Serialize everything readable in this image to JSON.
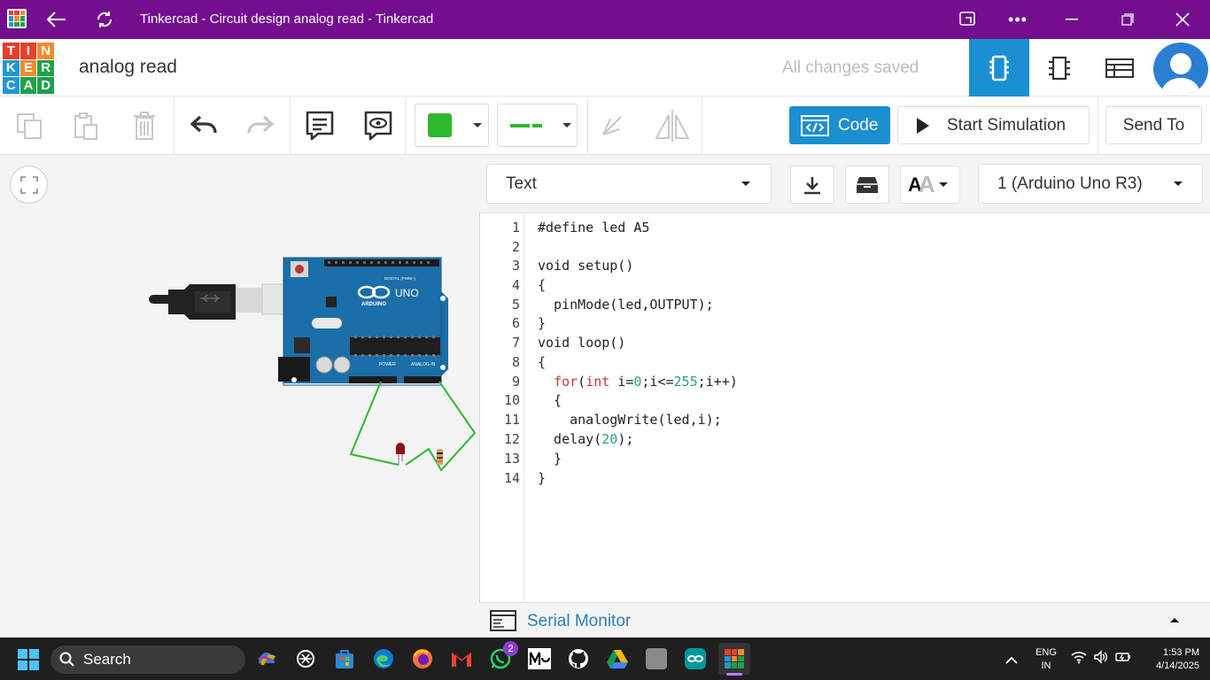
{
  "window": {
    "title": "Tinkercad - Circuit design analog read - Tinkercad"
  },
  "app": {
    "logo_letters": [
      "T",
      "I",
      "N",
      "K",
      "E",
      "R",
      "C",
      "A",
      "D"
    ],
    "logo_colors": [
      "#e23e2a",
      "#e8402c",
      "#f28b2b",
      "#2197d4",
      "#f28b2b",
      "#1fa14a",
      "#2197d4",
      "#1fa14a",
      "#1fa14a"
    ],
    "project_name": "analog read",
    "save_status": "All changes saved",
    "accent_color": "#1a8fd1"
  },
  "toolbar": {
    "code_label": "Code",
    "start_sim_label": "Start Simulation",
    "send_to_label": "Send To",
    "wire_color": "#2eb82e"
  },
  "code_panel": {
    "mode": "Text",
    "device": "1 (Arduino Uno R3)",
    "font_icon_label": "A",
    "lines": [
      "#define led A5",
      "",
      "void setup()",
      "{",
      "  pinMode(led,OUTPUT);",
      "}",
      "void loop()",
      "{",
      "  for(int i=0;i<=255;i++)",
      "  {",
      "    analogWrite(led,i);",
      "  delay(20);",
      "  }",
      "}"
    ],
    "line_numbers": [
      "1",
      "2",
      "3",
      "4",
      "5",
      "6",
      "7",
      "8",
      "9",
      "10",
      "11",
      "12",
      "13",
      "14"
    ],
    "serial_monitor_label": "Serial Monitor"
  },
  "board": {
    "brand": "ARDUINO",
    "model": "UNO",
    "labels": [
      "DIGITAL (PWM~)",
      "POWER",
      "ANALOG IN"
    ]
  },
  "taskbar": {
    "search_placeholder": "Search",
    "whatsapp_badge": "2",
    "lang": "ENG",
    "region": "IN",
    "time": "1:53 PM",
    "date": "4/14/2025"
  }
}
